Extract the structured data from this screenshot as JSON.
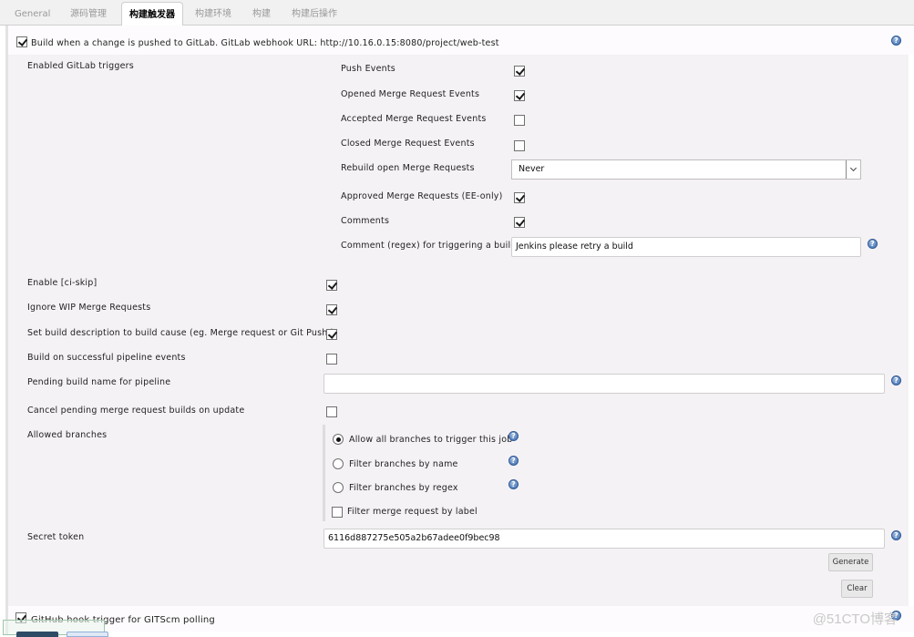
{
  "tabs": [
    {
      "label": "General",
      "active": false
    },
    {
      "label": "源码管理",
      "active": false
    },
    {
      "label": "构建触发器",
      "active": true
    },
    {
      "label": "构建环境",
      "active": false
    },
    {
      "label": "构建",
      "active": false
    },
    {
      "label": "构建后操作",
      "active": false
    }
  ],
  "gitlab_trigger": {
    "label": "Build when a change is pushed to GitLab. GitLab webhook URL: http://10.16.0.15:8080/project/web-test",
    "checked": true
  },
  "enabled_triggers": {
    "label": "Enabled GitLab triggers",
    "items": [
      {
        "label": "Push Events",
        "checked": true
      },
      {
        "label": "Opened Merge Request Events",
        "checked": true
      },
      {
        "label": "Accepted Merge Request Events",
        "checked": false
      },
      {
        "label": "Closed Merge Request Events",
        "checked": false
      }
    ],
    "rebuild": {
      "label": "Rebuild open Merge Requests",
      "value": "Never"
    },
    "items2": [
      {
        "label": "Approved Merge Requests (EE-only)",
        "checked": true
      },
      {
        "label": "Comments",
        "checked": true
      }
    ],
    "comment_regex": {
      "label": "Comment (regex) for triggering a build",
      "value": "Jenkins please retry a build"
    }
  },
  "options": [
    {
      "label": "Enable [ci-skip]",
      "checked": true
    },
    {
      "label": "Ignore WIP Merge Requests",
      "checked": true
    },
    {
      "label": "Set build description to build cause (eg. Merge request or Git Push )",
      "checked": true
    },
    {
      "label": "Build on successful pipeline events",
      "checked": false
    }
  ],
  "pending_build_name": {
    "label": "Pending build name for pipeline",
    "value": ""
  },
  "cancel_pending": {
    "label": "Cancel pending merge request builds on update",
    "checked": false
  },
  "allowed_branches": {
    "label": "Allowed branches",
    "radios": [
      {
        "label": "Allow all branches to trigger this job",
        "selected": true
      },
      {
        "label": "Filter branches by name",
        "selected": false
      },
      {
        "label": "Filter branches by regex",
        "selected": false
      }
    ],
    "filter_label": {
      "label": "Filter merge request by label",
      "checked": false
    }
  },
  "secret_token": {
    "label": "Secret token",
    "value": "6116d887275e505a2b67adee0f9bec98",
    "generate_label": "Generate",
    "clear_label": "Clear"
  },
  "github_hook": {
    "label": "GitHub hook trigger for GITScm polling",
    "checked": true
  },
  "watermark": "@51CTO博客",
  "help_glyph": "?"
}
